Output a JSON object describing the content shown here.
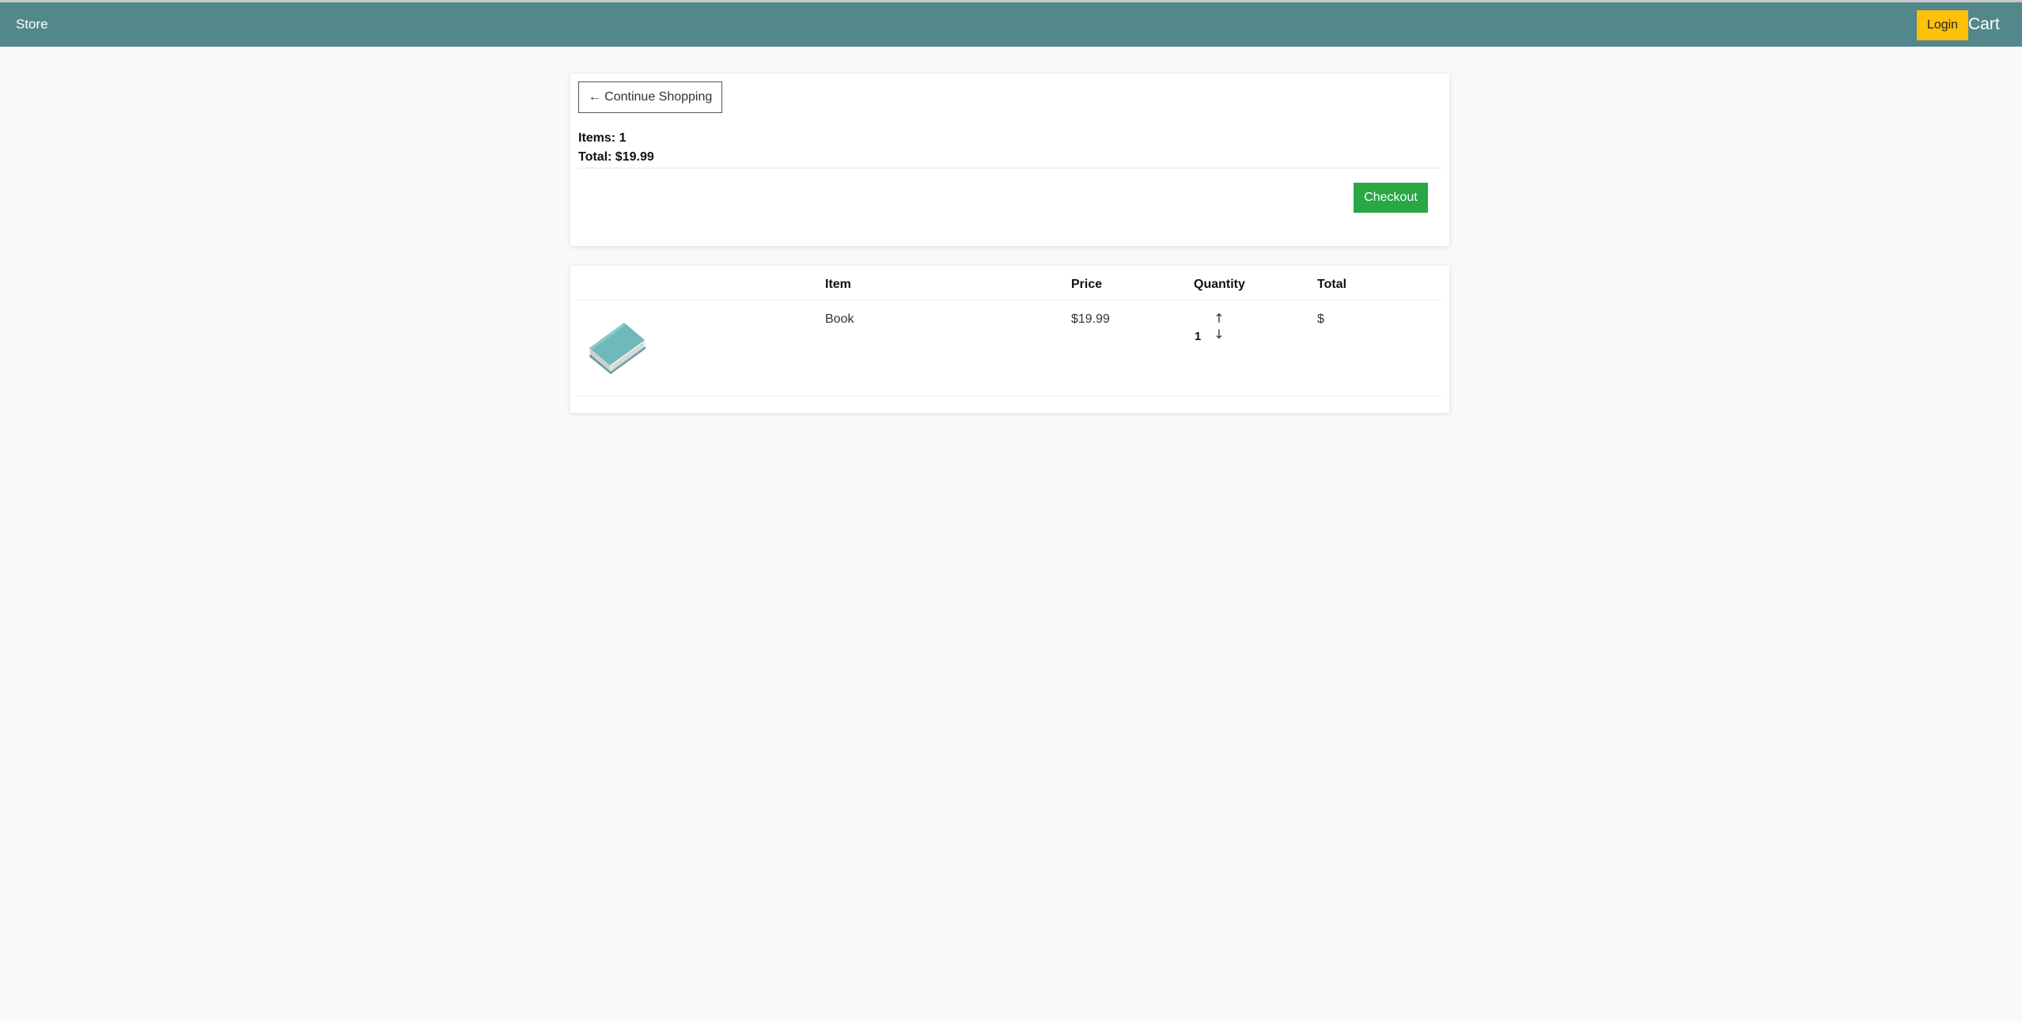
{
  "navbar": {
    "brand": "Store",
    "login_label": "Login",
    "cart_label": "Cart",
    "color": "#52878b",
    "login_color": "#ffc107"
  },
  "summary": {
    "continue_label": "← Continue Shopping",
    "items_text": "Items: 1",
    "total_text": "Total: $19.99",
    "checkout_label": "Checkout",
    "checkout_color": "#28a745"
  },
  "cart_table": {
    "headers": {
      "image": "",
      "item": "Item",
      "price": "Price",
      "quantity": "Quantity",
      "total": "Total"
    },
    "rows": [
      {
        "image_icon": "book-icon",
        "item": "Book",
        "price": "$19.99",
        "quantity": "1",
        "increase_icon": "↑",
        "decrease_icon": "↓",
        "total": "$"
      }
    ]
  }
}
